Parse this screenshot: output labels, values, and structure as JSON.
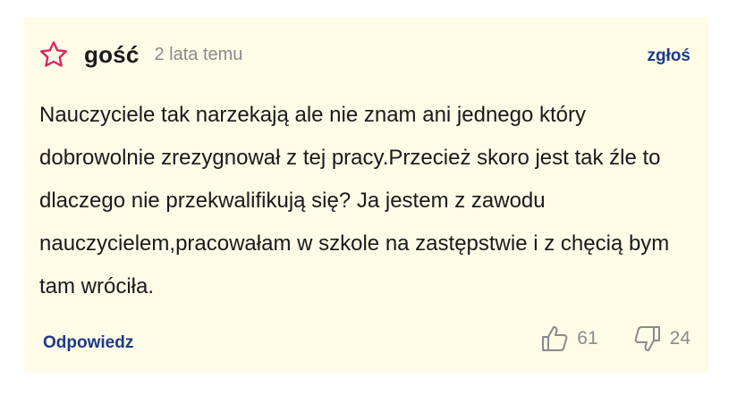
{
  "comment": {
    "author": "gość",
    "timestamp": "2 lata temu",
    "report_label": "zgłoś",
    "text": "Nauczyciele tak narzekają ale nie znam ani jednego który dobrowolnie zrezygnował z tej pracy.Przecież skoro jest tak źle to dlaczego nie przekwalifikują się? Ja jestem z zawodu nauczycielem,pracowałam w szkole na zastępstwie i z chęcią bym tam wróciła.",
    "reply_label": "Odpowiedz",
    "likes": "61",
    "dislikes": "24"
  },
  "icons": {
    "star": "star-outline-icon",
    "like": "thumbs-up-icon",
    "dislike": "thumbs-down-icon"
  },
  "colors": {
    "card_background": "#fefbe7",
    "star": "#e0245e",
    "link": "#1b3a8a",
    "muted": "#8a8a8a",
    "text": "#1a1a1a"
  }
}
